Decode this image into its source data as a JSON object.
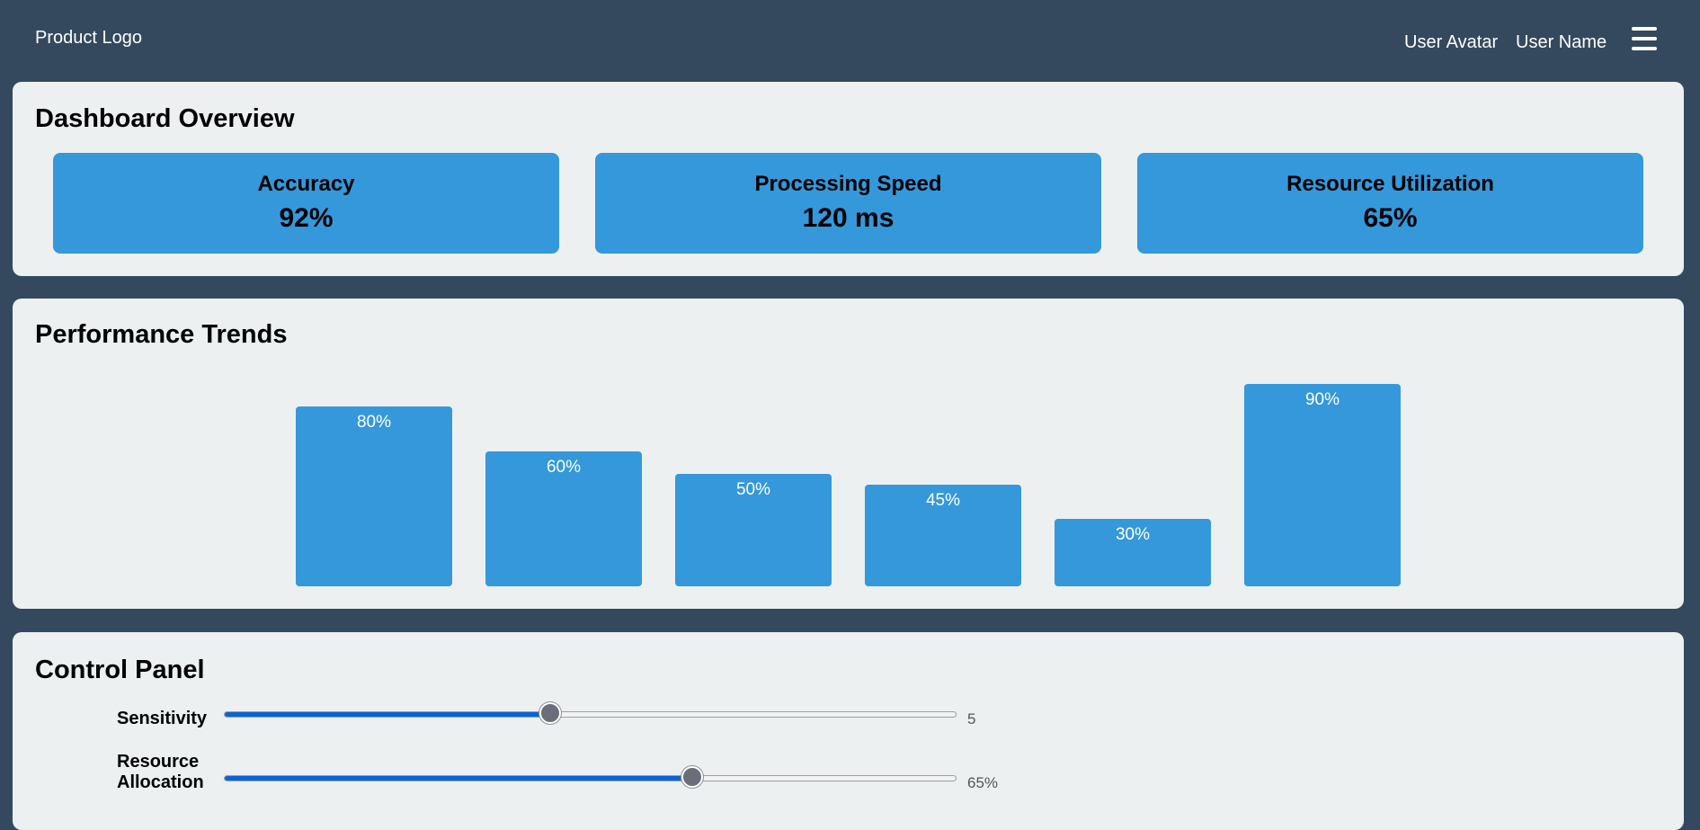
{
  "header": {
    "logo_text": "Product Logo",
    "avatar_text": "User Avatar",
    "user_name": "User Name",
    "menu_icon": "hamburger-menu-icon"
  },
  "overview": {
    "title": "Dashboard Overview",
    "metrics": [
      {
        "label": "Accuracy",
        "value": "92%"
      },
      {
        "label": "Processing Speed",
        "value": "120 ms"
      },
      {
        "label": "Resource Utilization",
        "value": "65%"
      }
    ]
  },
  "trends": {
    "title": "Performance Trends"
  },
  "chart_data": {
    "type": "bar",
    "values": [
      80,
      60,
      50,
      45,
      30,
      90
    ],
    "labels": [
      "80%",
      "60%",
      "50%",
      "45%",
      "30%",
      "90%"
    ],
    "ylim": [
      0,
      100
    ]
  },
  "controls": {
    "title": "Control Panel",
    "sliders": [
      {
        "label": "Sensitivity",
        "value": "5",
        "fraction": 0.445
      },
      {
        "label": "Resource Allocation",
        "value": "65%",
        "fraction": 0.64
      }
    ]
  },
  "colors": {
    "background": "#34495e",
    "panel": "#ecf0f1",
    "accent": "#3498db",
    "slider_fill": "#0b63d6"
  }
}
